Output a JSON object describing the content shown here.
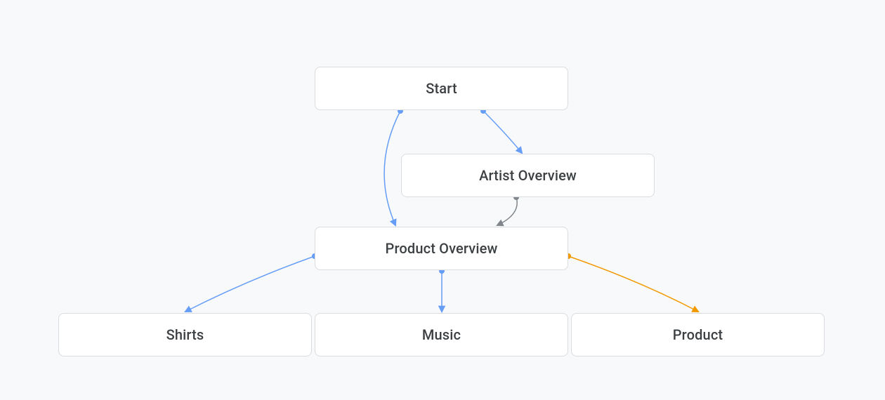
{
  "nodes": {
    "start": {
      "label": "Start"
    },
    "artist_overview": {
      "label": "Artist Overview"
    },
    "product_overview": {
      "label": "Product Overview"
    },
    "shirts": {
      "label": "Shirts"
    },
    "music": {
      "label": "Music"
    },
    "product": {
      "label": "Product"
    }
  },
  "colors": {
    "blue": "#669df6",
    "gray": "#80868b",
    "orange": "#f29900"
  }
}
